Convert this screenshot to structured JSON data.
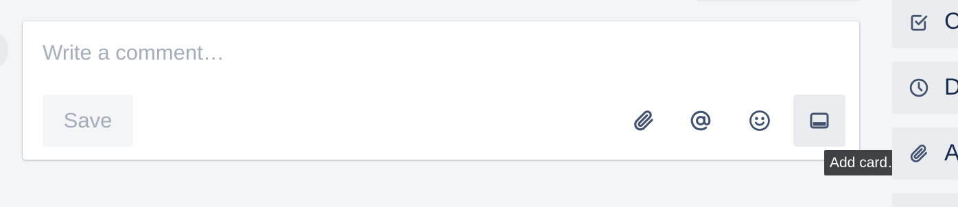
{
  "comment": {
    "placeholder": "Write a comment…",
    "save_label": "Save"
  },
  "toolbar": {
    "items": [
      {
        "icon": "paperclip-icon",
        "active": false
      },
      {
        "icon": "at-mention-icon",
        "active": false
      },
      {
        "icon": "emoji-icon",
        "active": false
      },
      {
        "icon": "card-icon",
        "active": true
      }
    ],
    "tooltip": "Add card…"
  },
  "sidebar": {
    "items": [
      {
        "icon": "checklist-icon",
        "label": "C"
      },
      {
        "icon": "clock-icon",
        "label": "D"
      },
      {
        "icon": "paperclip-icon",
        "label": "A"
      }
    ]
  },
  "colors": {
    "background": "#f4f5f7",
    "text": "#172b4d",
    "icon": "#42526e",
    "muted": "#a5adba",
    "tooltip_bg": "#3f4245"
  }
}
